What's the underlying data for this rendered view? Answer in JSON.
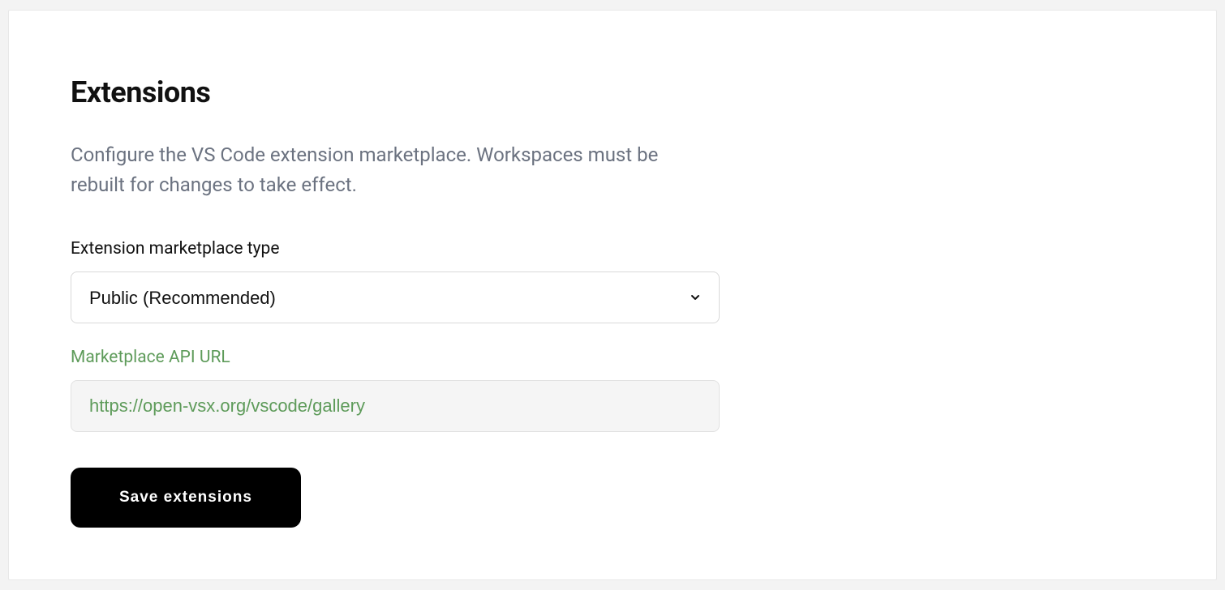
{
  "header": {
    "title": "Extensions",
    "description": "Configure the VS Code extension marketplace. Workspaces must be rebuilt for changes to take effect."
  },
  "form": {
    "marketplace_type": {
      "label": "Extension marketplace type",
      "value": "Public (Recommended)"
    },
    "api_url": {
      "label": "Marketplace API URL",
      "value": "https://open-vsx.org/vscode/gallery"
    },
    "save_button": "Save extensions"
  }
}
